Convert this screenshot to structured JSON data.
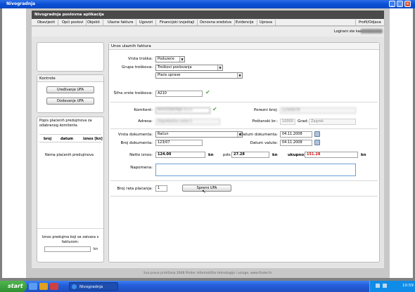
{
  "window": {
    "title": "Nivogradnja"
  },
  "app": {
    "header_title": "Nivogradnja poslovna aplikacija",
    "menu": [
      "Obavijesti",
      "Opći poslovi",
      "Objekti",
      "Ulazne fakture",
      "Ugovori",
      "Financijski izvještaji",
      "Osnovna sredstva",
      "Evidencije",
      "Uprava"
    ],
    "profile_link": "Profil/Odjava",
    "logged_in": "Logirani ste kao:"
  },
  "sidebar": {
    "kontrole": {
      "title": "Kontrole",
      "edit_btn": "Uređivanje UFA",
      "add_btn": "Dodavanje UFA"
    },
    "prepayments": {
      "title": "Popis plaćenih predujmova za odabranog komitenta",
      "columns": [
        "broj",
        "datum",
        "iznos [kn]"
      ],
      "empty": "Nema plaćenih predujmova",
      "amount_label": "Iznos predujma koji se zatvara s fakturom:",
      "unit": "kn"
    }
  },
  "form": {
    "title": "Unos ulaznih faktura",
    "vrsta_troska": {
      "label": "Vrsta troška:",
      "value": "Poduzeće"
    },
    "grupa_troska": {
      "label": "Grupa troškova:",
      "value": "Troškovi poslovanja"
    },
    "podgrupa": {
      "value": "Plaće uprave"
    },
    "sifra": {
      "label": "Šifra vrste troškova:",
      "value": "A210"
    },
    "komitent": {
      "label": "Komitent:",
      "value": "NIVOGRADNJA d.o.o"
    },
    "adresa": {
      "label": "Adresa:",
      "value": "Zagrebačka cesta 1"
    },
    "porezni_broj": {
      "label": "Porezni broj:",
      "value": "12345678"
    },
    "postanski": {
      "label": "Poštanski br.:",
      "value": "10000"
    },
    "grad": {
      "label": "Grad:",
      "value": "Zagreb"
    },
    "vrsta_dokumenta": {
      "label": "Vrsta dokumenta:",
      "value": "Račun"
    },
    "datum_dokumenta": {
      "label": "Datum dokumenta:",
      "value": "04.11.2008"
    },
    "broj_dokumenta": {
      "label": "Broj dokumenta:",
      "value": "123/07"
    },
    "datum_valute": {
      "label": "Datum valute:",
      "value": "04.11.2008"
    },
    "neto": {
      "label": "Netto iznos:",
      "value": "124.00",
      "unit": "kn"
    },
    "pdv": {
      "label": "pdv:",
      "value": "27.28",
      "unit": "kn"
    },
    "ukupno": {
      "label": "ukupno:",
      "value": "151.28",
      "unit": "kn"
    },
    "napomena": {
      "label": "Napomena:",
      "value": ""
    },
    "broj_rata": {
      "label": "Broj rata plaćanja:",
      "value": "1"
    },
    "save_btn": "Spremi UFA"
  },
  "footer": {
    "text": "Sva prava pridržana 2008 Pinder informatičke tehnologije i usluge, www.finder.hr"
  },
  "taskbar": {
    "start": "start",
    "task": "Nivogradnja",
    "clock": "10:59"
  },
  "colors": {
    "titlebar": "#0a4fd4",
    "header": "#4a4a4a",
    "ukupno": "#d01010",
    "check": "#48a83a",
    "taskbar": "#245edb"
  }
}
